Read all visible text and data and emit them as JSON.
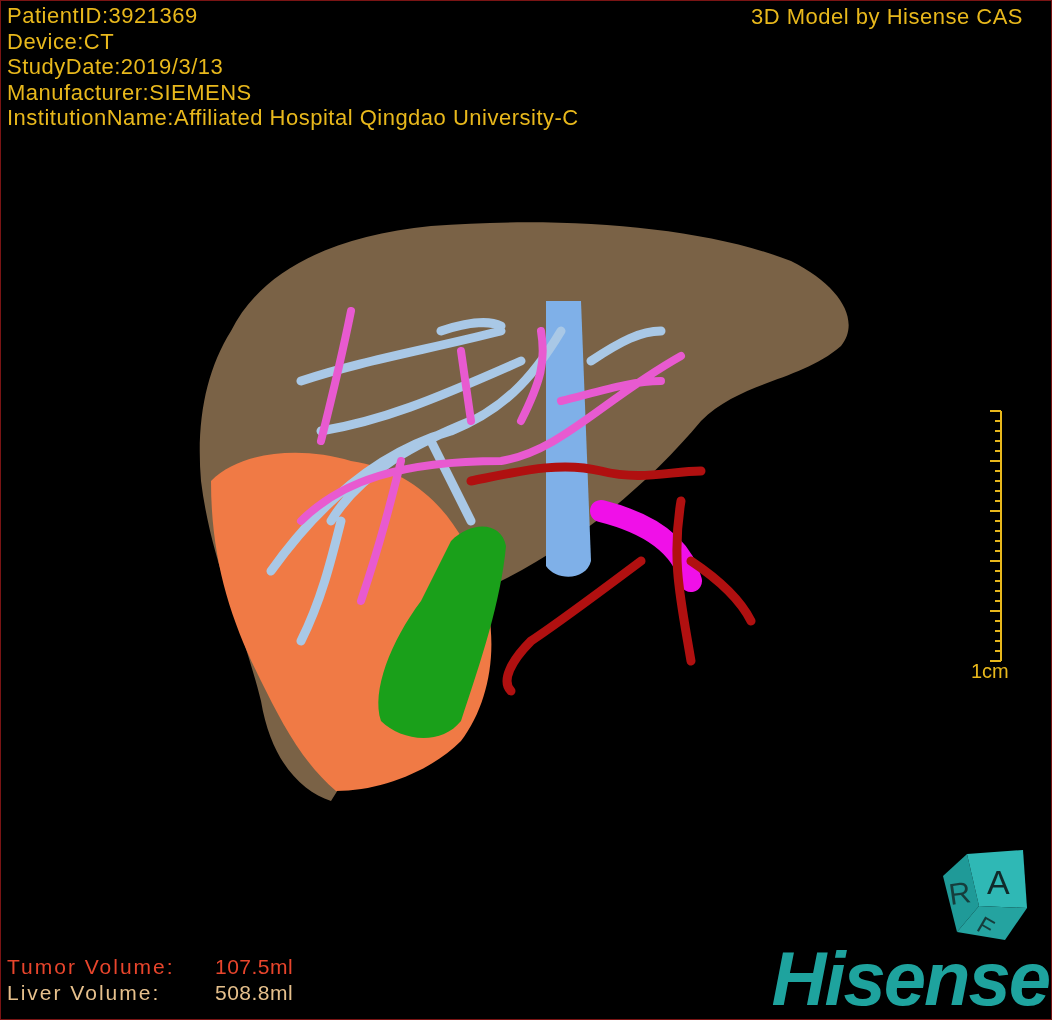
{
  "info_lines": [
    "PatientID:3921369",
    "Device:CT",
    "StudyDate:2019/3/13",
    "Manufacturer:SIEMENS",
    "InstitutionName:Affiliated Hospital Qingdao University-C"
  ],
  "title": "3D Model by Hisense CAS",
  "scale_bar": {
    "label": "1cm"
  },
  "volumes": [
    {
      "label": "Tumor Volume:",
      "value": "107.5ml",
      "color": "#e8452c"
    },
    {
      "label": "Liver Volume:",
      "value": "508.8ml",
      "color": "#e6c08c"
    }
  ],
  "orientation_cube": {
    "faces": [
      "R",
      "A",
      "F"
    ]
  },
  "logo": "Hisense"
}
